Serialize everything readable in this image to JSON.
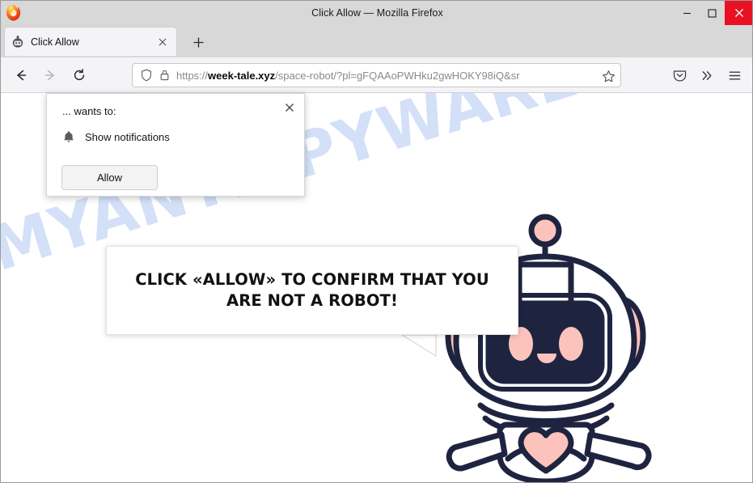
{
  "window": {
    "title": "Click Allow — Mozilla Firefox",
    "controls": {
      "minimize": "—",
      "maximize": "☐",
      "close": "✕"
    },
    "close_color": "#e81123"
  },
  "tabs": [
    {
      "title": "Click Allow",
      "favicon": "robot-favicon",
      "close": "✕"
    }
  ],
  "newtab": {
    "label": "+"
  },
  "nav": {
    "back": "←",
    "forward": "→",
    "reload": "⟳"
  },
  "urlbar": {
    "shield_icon": "shield-icon",
    "lock_icon": "lock-icon",
    "scheme": "https://",
    "host": "week-tale.xyz",
    "path": "/space-robot/?pl=gFQAAoPWHku2gwHOKY98iQ&sr",
    "full_url": "https://week-tale.xyz/space-robot/?pl=gFQAAoPWHku2gwHOKY98iQ&sr",
    "bookmark_icon": "star-icon"
  },
  "toolbar_right": {
    "pocket": "pocket-icon",
    "overflow": "»",
    "menu": "hamburger-menu-icon"
  },
  "permission_popup": {
    "host_text": "... wants to:",
    "permission_label": "Show notifications",
    "bell_icon": "bell-icon",
    "close_icon": "✕",
    "allow_button": "Allow"
  },
  "speech_bubble": {
    "line1": "CLICK «ALLOW» TO CONFIRM THAT YOU",
    "line2": "ARE NOT A ROBOT!",
    "text": "CLICK «ALLOW» TO CONFIRM THAT YOU ARE NOT A ROBOT!"
  },
  "watermark": {
    "text": "MYANTISPYWARE.COM",
    "color": "#d3e0f8"
  },
  "illustration": {
    "name": "space-robot-mascot",
    "outline_color": "#1e2440",
    "accent_color": "#fbc3bc",
    "screen_color": "#1e2440"
  }
}
